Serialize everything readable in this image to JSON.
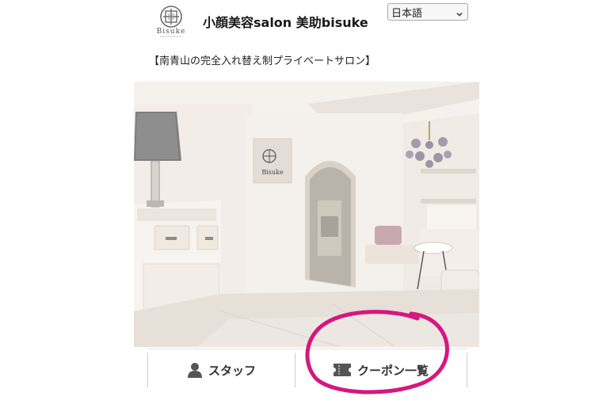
{
  "header": {
    "logo_text": "Bisuke",
    "brand_title": "小顔美容salon 美助bisuke",
    "language_select": {
      "selected": "日本語",
      "options": [
        "日本語"
      ]
    }
  },
  "tagline": "【南青山の完全入れ替え制プライベートサロン】",
  "photo": {
    "alt_label": "Bisuke",
    "icon": "salon-interior-photo"
  },
  "bottom_nav": {
    "items": [
      {
        "label": "スタッフ",
        "icon": "person-icon"
      },
      {
        "label": "クーポン一覧",
        "icon": "ticket-icon"
      }
    ]
  },
  "annotation": {
    "color": "#d6177f",
    "shape": "hand-drawn-circle"
  },
  "colors": {
    "text": "#1a1a1a",
    "icon": "#555555",
    "annotation": "#d6177f"
  }
}
